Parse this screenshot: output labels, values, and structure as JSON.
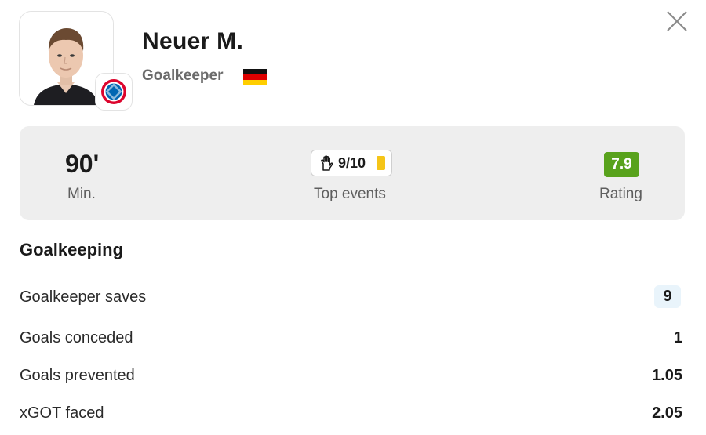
{
  "player": {
    "name": "Neuer M.",
    "position": "Goalkeeper",
    "nationality_flag": "germany-flag",
    "club_badge": "bayern-munich-badge"
  },
  "summary": {
    "minutes": "90'",
    "minutes_label": "Min.",
    "top_events": {
      "saves": "9/10",
      "saves_icon": "goalkeeper-glove-icon",
      "card_icon": "yellow-card-icon",
      "card_color": "#f5c518"
    },
    "top_events_label": "Top events",
    "rating": "7.9",
    "rating_label": "Rating",
    "rating_color": "#58a21c"
  },
  "goalkeeping": {
    "title": "Goalkeeping",
    "stats": [
      {
        "label": "Goalkeeper saves",
        "value": "9"
      },
      {
        "label": "Goals conceded",
        "value": "1"
      },
      {
        "label": "Goals prevented",
        "value": "1.05"
      },
      {
        "label": "xGOT faced",
        "value": "2.05"
      }
    ]
  },
  "close_icon": "close-icon"
}
